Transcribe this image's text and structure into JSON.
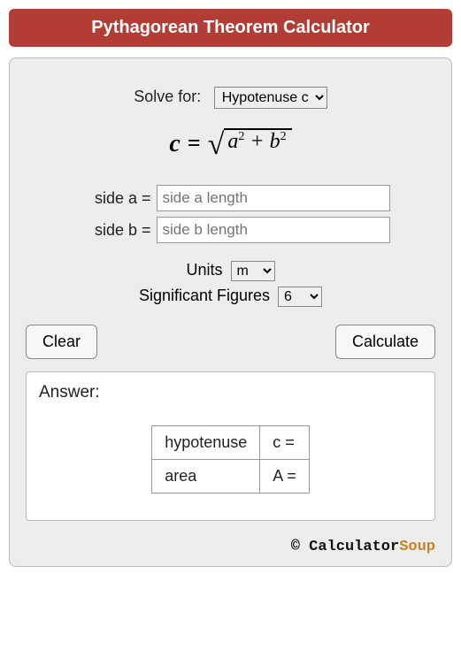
{
  "title": "Pythagorean Theorem Calculator",
  "solve": {
    "label": "Solve for:",
    "selected": "Hypotenuse c"
  },
  "formula": {
    "lhs": "c",
    "rhs_a": "a",
    "rhs_b": "b"
  },
  "inputs": {
    "a": {
      "label": "side a =",
      "placeholder": "side a length",
      "value": ""
    },
    "b": {
      "label": "side b =",
      "placeholder": "side b length",
      "value": ""
    }
  },
  "units": {
    "label": "Units",
    "selected": "m"
  },
  "sigfigs": {
    "label": "Significant Figures",
    "selected": "6"
  },
  "buttons": {
    "clear": "Clear",
    "calculate": "Calculate"
  },
  "answer": {
    "label": "Answer:",
    "rows": [
      {
        "name": "hypotenuse",
        "sym": "c =",
        "val": ""
      },
      {
        "name": "area",
        "sym": "A =",
        "val": ""
      }
    ]
  },
  "footer": {
    "prefix": "© Calculator",
    "suffix": "Soup"
  }
}
